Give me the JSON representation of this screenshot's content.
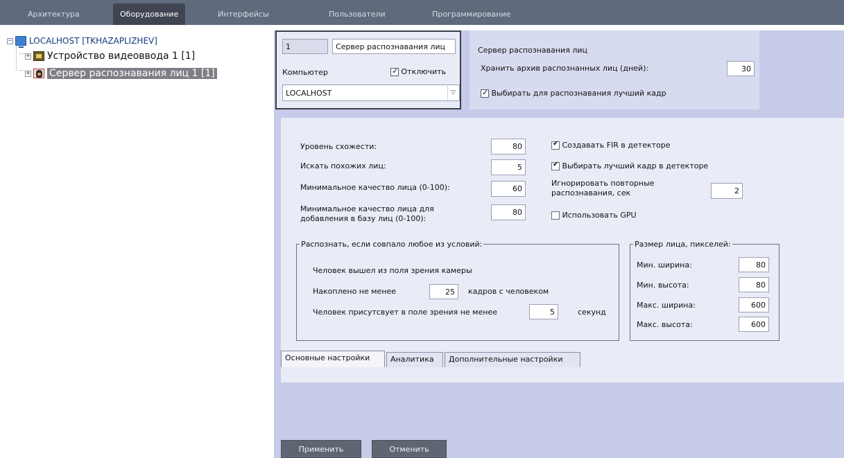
{
  "menu": {
    "tabs": [
      "Архитектура",
      "Оборудование",
      "Интерфейсы",
      "Пользователи",
      "Программирование"
    ],
    "active_index": 1
  },
  "tree": {
    "root_label": "LOCALHOST [TKHAZAPLIZHEV]",
    "items": [
      {
        "label": "Устройство видеоввода 1 [1]",
        "icon": "video-input-device-icon"
      },
      {
        "label": "Сервер распознавания лиц 1 [1]",
        "icon": "face-server-icon",
        "selected": true
      }
    ]
  },
  "object": {
    "id": "1",
    "name": "Сервер распознавания лиц",
    "computer_label": "Компьютер",
    "disable_label": "Отключить",
    "disable_checked": true,
    "computer_value": "LOCALHOST"
  },
  "server": {
    "section_title": "Сервер распознавания лиц",
    "archive_label": "Хранить архив распознанных лиц (дней):",
    "archive_days": "30",
    "best_frame_label": "Выбирать для распознавания лучший кадр",
    "best_frame_checked": true
  },
  "main": {
    "similarity_label": "Уровень схожести:",
    "similarity_value": "80",
    "search_similar_label": "Искать похожих лиц:",
    "search_similar_value": "5",
    "min_quality_label": "Минимальное качество лица (0-100):",
    "min_quality_value": "60",
    "min_quality_db_label_1": "Минимальное качество лица для",
    "min_quality_db_label_2": "добавления в базу лиц (0-100):",
    "min_quality_db_value": "80",
    "create_fir_label": "Создавать FIR в детекторе",
    "create_fir_checked": true,
    "best_frame_detector_label": "Выбирать лучший кадр в детекторе",
    "best_frame_detector_checked": true,
    "ignore_repeat_label_1": "Игнорировать повторные",
    "ignore_repeat_label_2": "распознавания, сек",
    "ignore_repeat_value": "2",
    "use_gpu_label": "Использовать GPU",
    "use_gpu_checked": false
  },
  "conditions": {
    "legend": "Распознать, если совпало любое из условий:",
    "left_view_label": "Человек вышел из поля зрения камеры",
    "accumulated_label": "Накоплено не менее",
    "accumulated_value": "25",
    "accumulated_suffix": "кадров с человеком",
    "present_label": "Человек присутсвует в поле зрения не менее",
    "present_value": "5",
    "present_suffix": "секунд"
  },
  "face_size": {
    "legend": "Размер лица, пикселей:",
    "min_width_label": "Мин. ширина:",
    "min_width_value": "80",
    "min_height_label": "Мин. высота:",
    "min_height_value": "80",
    "max_width_label": "Макс. ширина:",
    "max_width_value": "600",
    "max_height_label": "Макс. высота:",
    "max_height_value": "600"
  },
  "bottom_tabs": [
    "Основные настройки",
    "Аналитика",
    "Дополнительные настройки"
  ],
  "buttons": {
    "apply": "Применить",
    "cancel": "Отменить"
  },
  "colors": {
    "topbar": "#5f6b7d",
    "panel_bg": "#c5cbe8",
    "selected_tree_bg": "#7d7f85"
  }
}
